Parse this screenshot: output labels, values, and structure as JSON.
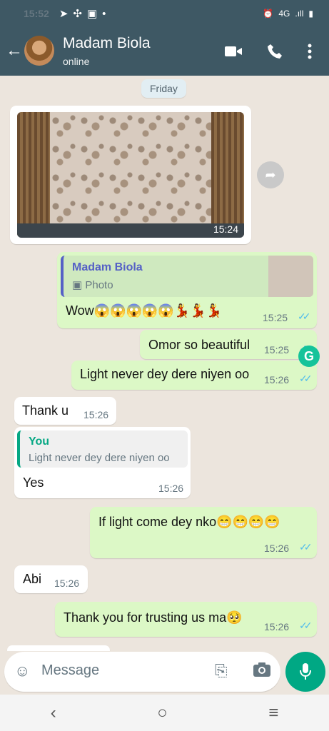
{
  "status_bar": {
    "time": "15:52",
    "network": "4G",
    "signal": ".ıll"
  },
  "header": {
    "contact_name": "Madam Biola",
    "presence": "online"
  },
  "chat": {
    "day_chip": "Friday",
    "photo_time": "15:24",
    "messages": [
      {
        "text": "Madam Biola",
        "type": "quote_name"
      },
      {
        "text": "Photo",
        "type": "quote_text"
      },
      {
        "text": "Wow😱😱😱😱😱💃💃💃",
        "time": "15:25"
      },
      {
        "text": "Omor so beautiful",
        "time": "15:25"
      },
      {
        "text": "Light never dey dere niyen oo",
        "time": "15:26"
      },
      {
        "text": "Thank u",
        "time": "15:26"
      },
      {
        "text": "You",
        "type": "quote_name"
      },
      {
        "text": "Light never dey dere niyen oo",
        "type": "quote_text"
      },
      {
        "text": "Yes",
        "time": "15:26"
      },
      {
        "text": "If light come dey nko😁😁😁😁",
        "time": "15:26"
      },
      {
        "text": "Abi",
        "time": "15:26"
      },
      {
        "text": "Thank you for trusting us ma🥺",
        "time": "15:26"
      }
    ]
  },
  "composer": {
    "placeholder": "Message"
  },
  "colors": {
    "header": "#3e5864",
    "outgoing": "#dcf8c6",
    "accent": "#00a884",
    "ticks": "#53bdeb"
  }
}
